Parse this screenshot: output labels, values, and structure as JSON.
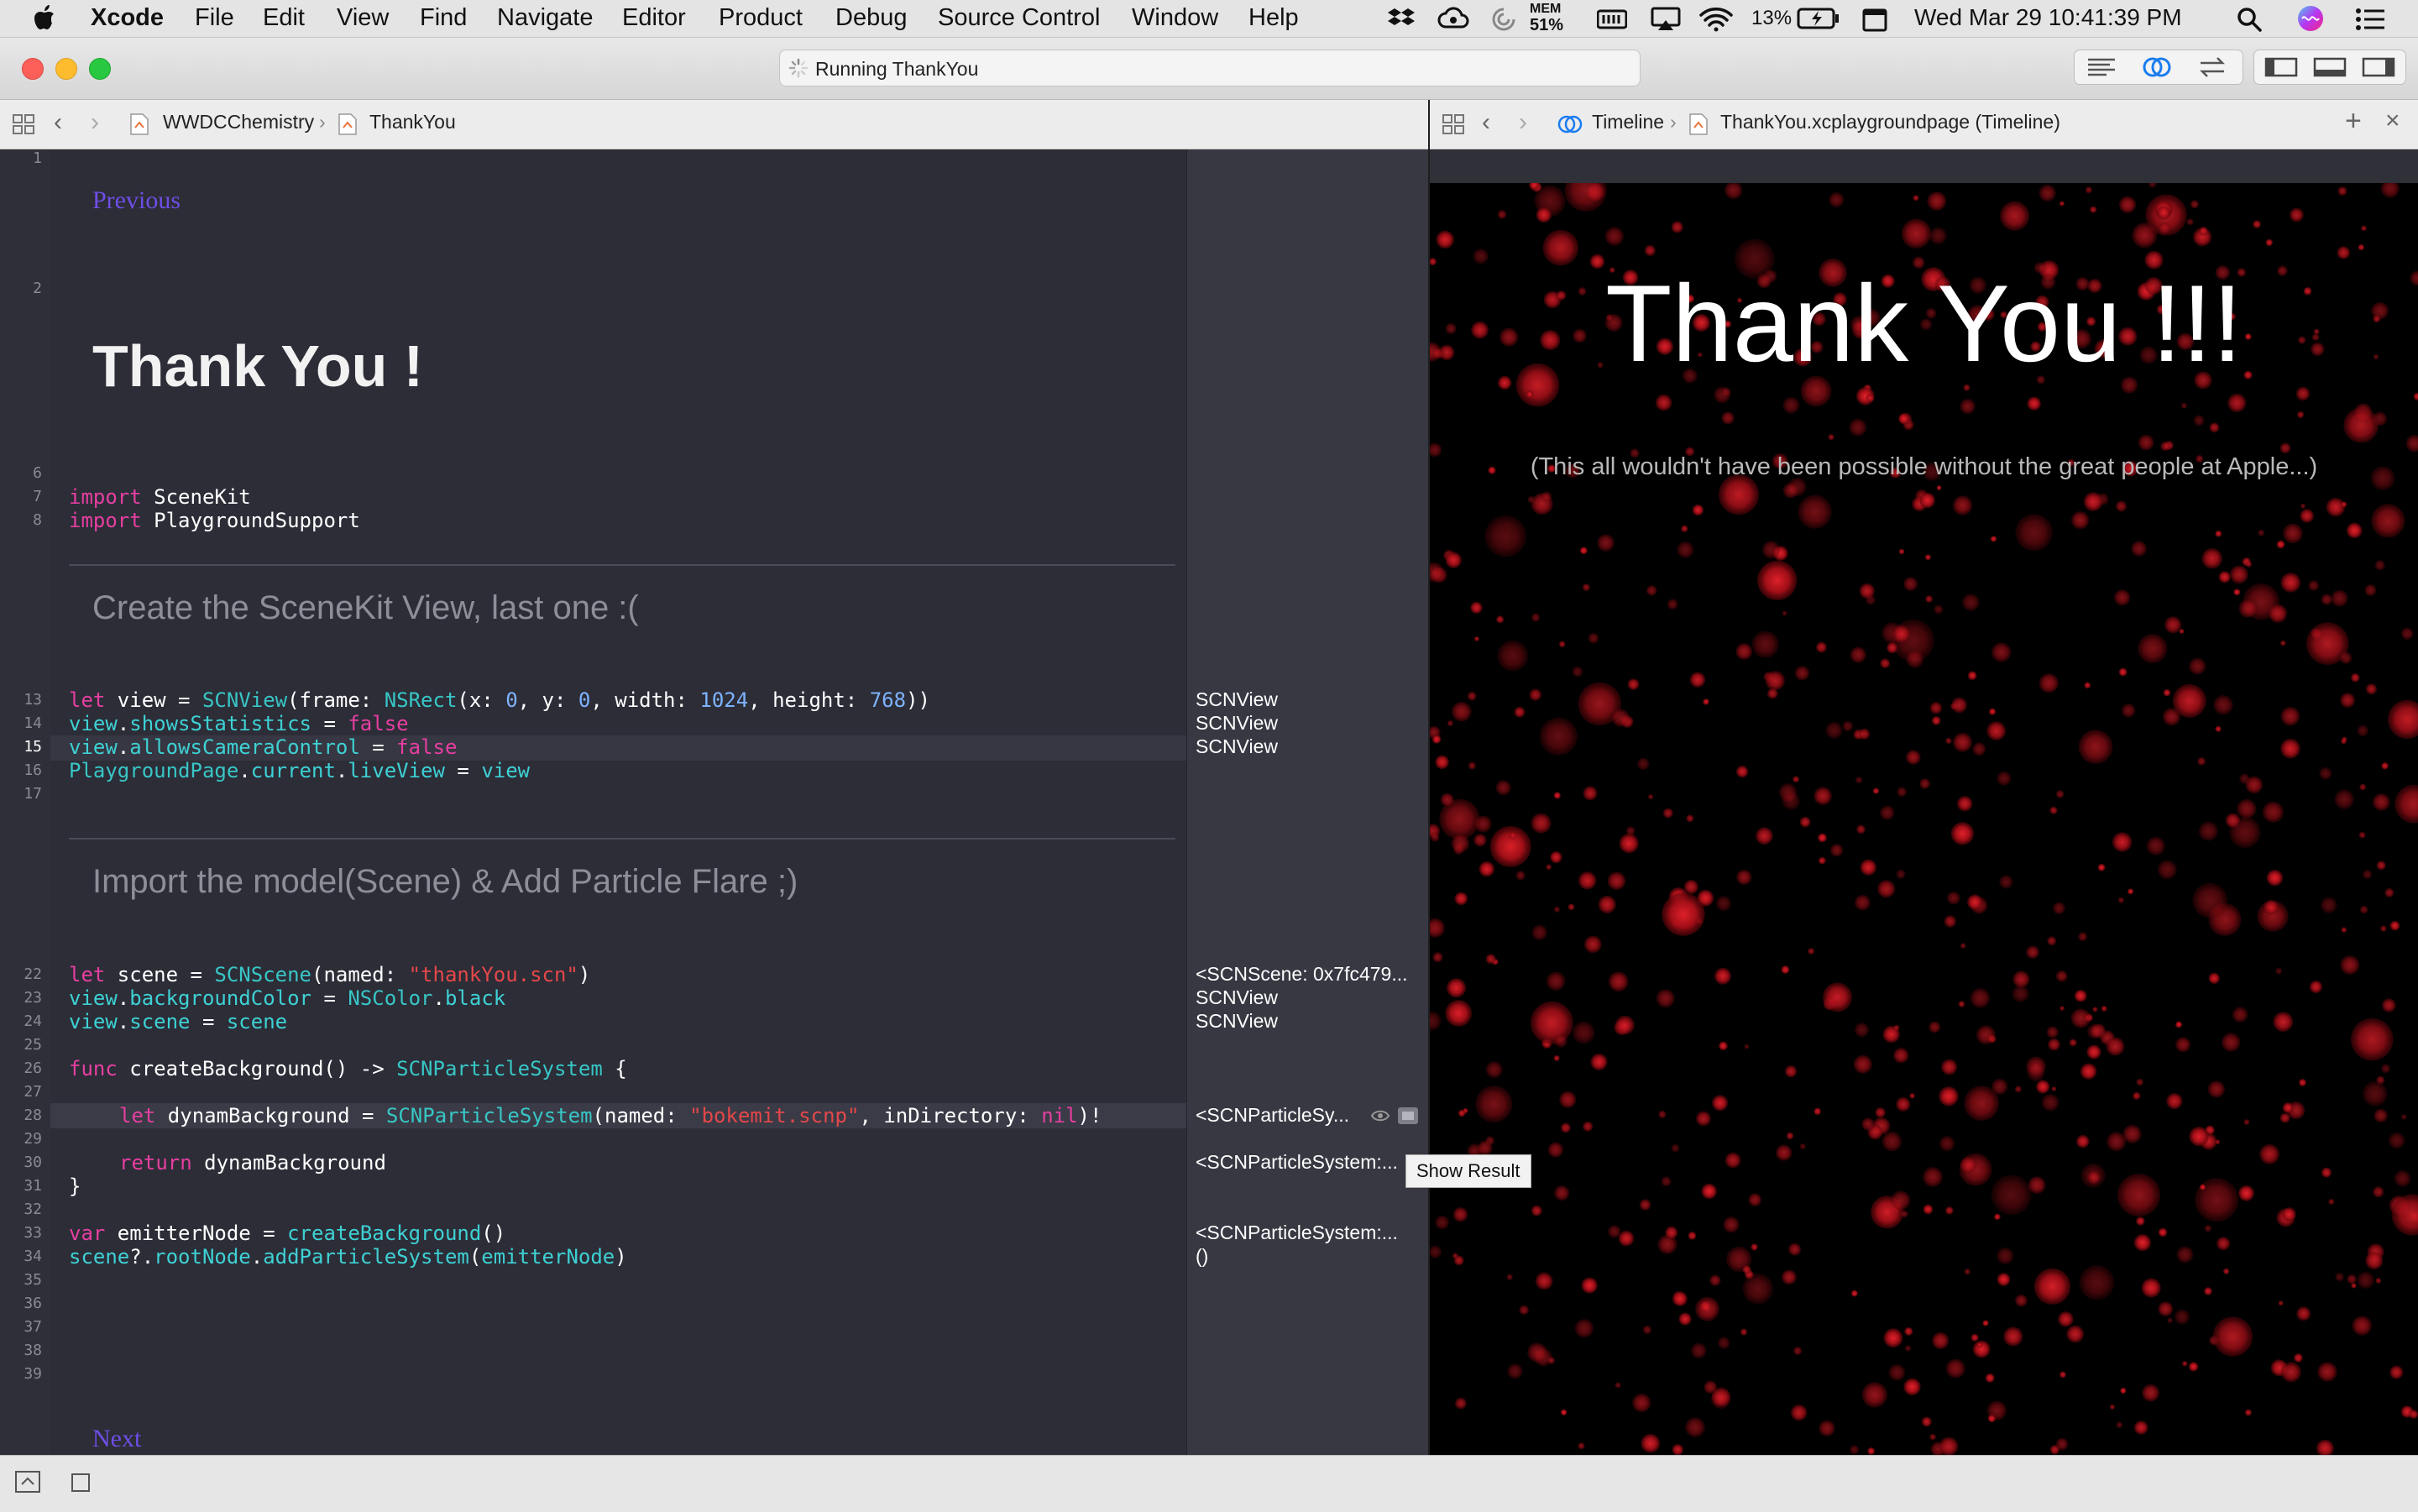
{
  "menubar": {
    "app": "Xcode",
    "items": [
      "File",
      "Edit",
      "View",
      "Find",
      "Navigate",
      "Editor",
      "Product",
      "Debug",
      "Source Control",
      "Window",
      "Help"
    ],
    "mem_label": "MEM",
    "mem_value": "51%",
    "battery": "13%",
    "clock": "Wed Mar 29  10:41:39 PM"
  },
  "window": {
    "activity": "Running ThankYou"
  },
  "editor_jump": {
    "project": "WWDCChemistry",
    "page": "ThankYou"
  },
  "assistant_jump": {
    "mode": "Timeline",
    "file": "ThankYou.xcplaygroundpage (Timeline)"
  },
  "markup": {
    "previous": "Previous",
    "title": "Thank You !",
    "heading1": "Create the SceneKit View, last one :(",
    "heading2": "Import the model(Scene) & Add Particle Flare ;)",
    "next": "Next"
  },
  "line_numbers": [
    "1",
    "2",
    "6",
    "7",
    "8",
    "13",
    "14",
    "15",
    "16",
    "17",
    "22",
    "23",
    "24",
    "25",
    "26",
    "27",
    "28",
    "29",
    "30",
    "31",
    "32",
    "33",
    "34",
    "35",
    "36",
    "37",
    "38",
    "39"
  ],
  "code": {
    "l7": [
      "import",
      " SceneKit"
    ],
    "l8": [
      "import",
      " PlaygroundSupport"
    ],
    "l13": [
      "let",
      " view = ",
      "SCNView",
      "(frame: ",
      "NSRect",
      "(x: ",
      "0",
      ", y: ",
      "0",
      ", width: ",
      "1024",
      ", height: ",
      "768",
      "))"
    ],
    "l14": [
      "view",
      ".",
      "showsStatistics",
      " = ",
      "false"
    ],
    "l15": [
      "view",
      ".",
      "allowsCameraControl",
      " = ",
      "false"
    ],
    "l16": [
      "PlaygroundPage",
      ".",
      "current",
      ".",
      "liveView",
      " = ",
      "view"
    ],
    "l22": [
      "let",
      " scene = ",
      "SCNScene",
      "(named: ",
      "\"thankYou.scn\"",
      ")"
    ],
    "l23": [
      "view",
      ".",
      "backgroundColor",
      " = ",
      "NSColor",
      ".",
      "black"
    ],
    "l24": [
      "view",
      ".",
      "scene",
      " = ",
      "scene"
    ],
    "l26": [
      "func",
      " createBackground() -> ",
      "SCNParticleSystem",
      " {"
    ],
    "l28": [
      "let",
      " dynamBackground = ",
      "SCNParticleSystem",
      "(named: ",
      "\"bokemit.scnp\"",
      ", inDirectory: ",
      "nil",
      ")!"
    ],
    "l30": [
      "return",
      " dynamBackground"
    ],
    "l31": [
      "}"
    ],
    "l33": [
      "var",
      " emitterNode = ",
      "createBackground",
      "()"
    ],
    "l34": [
      "scene",
      "?.",
      "rootNode",
      ".",
      "addParticleSystem",
      "(",
      "emitterNode",
      ")"
    ]
  },
  "results": {
    "r13": "SCNView",
    "r14": "SCNView",
    "r15": "SCNView",
    "r22": "<SCNScene: 0x7fc479...",
    "r23": "SCNView",
    "r24": "SCNView",
    "r28": "<SCNParticleSy...",
    "r30": "<SCNParticleSystem:...",
    "r33": "<SCNParticleSystem:...",
    "r34": "()"
  },
  "tooltip": "Show Result",
  "live_view": {
    "title": "Thank You !!!",
    "subtitle": "(This all wouldn't have been possible without the great people at Apple...)",
    "particle_color": "#c8141e",
    "background": "#000000"
  },
  "colors": {
    "keyword": "#e63fa1",
    "type": "#38c6c6",
    "number": "#7fb3ff",
    "string": "#e5474a",
    "link": "#6f4ee6"
  }
}
